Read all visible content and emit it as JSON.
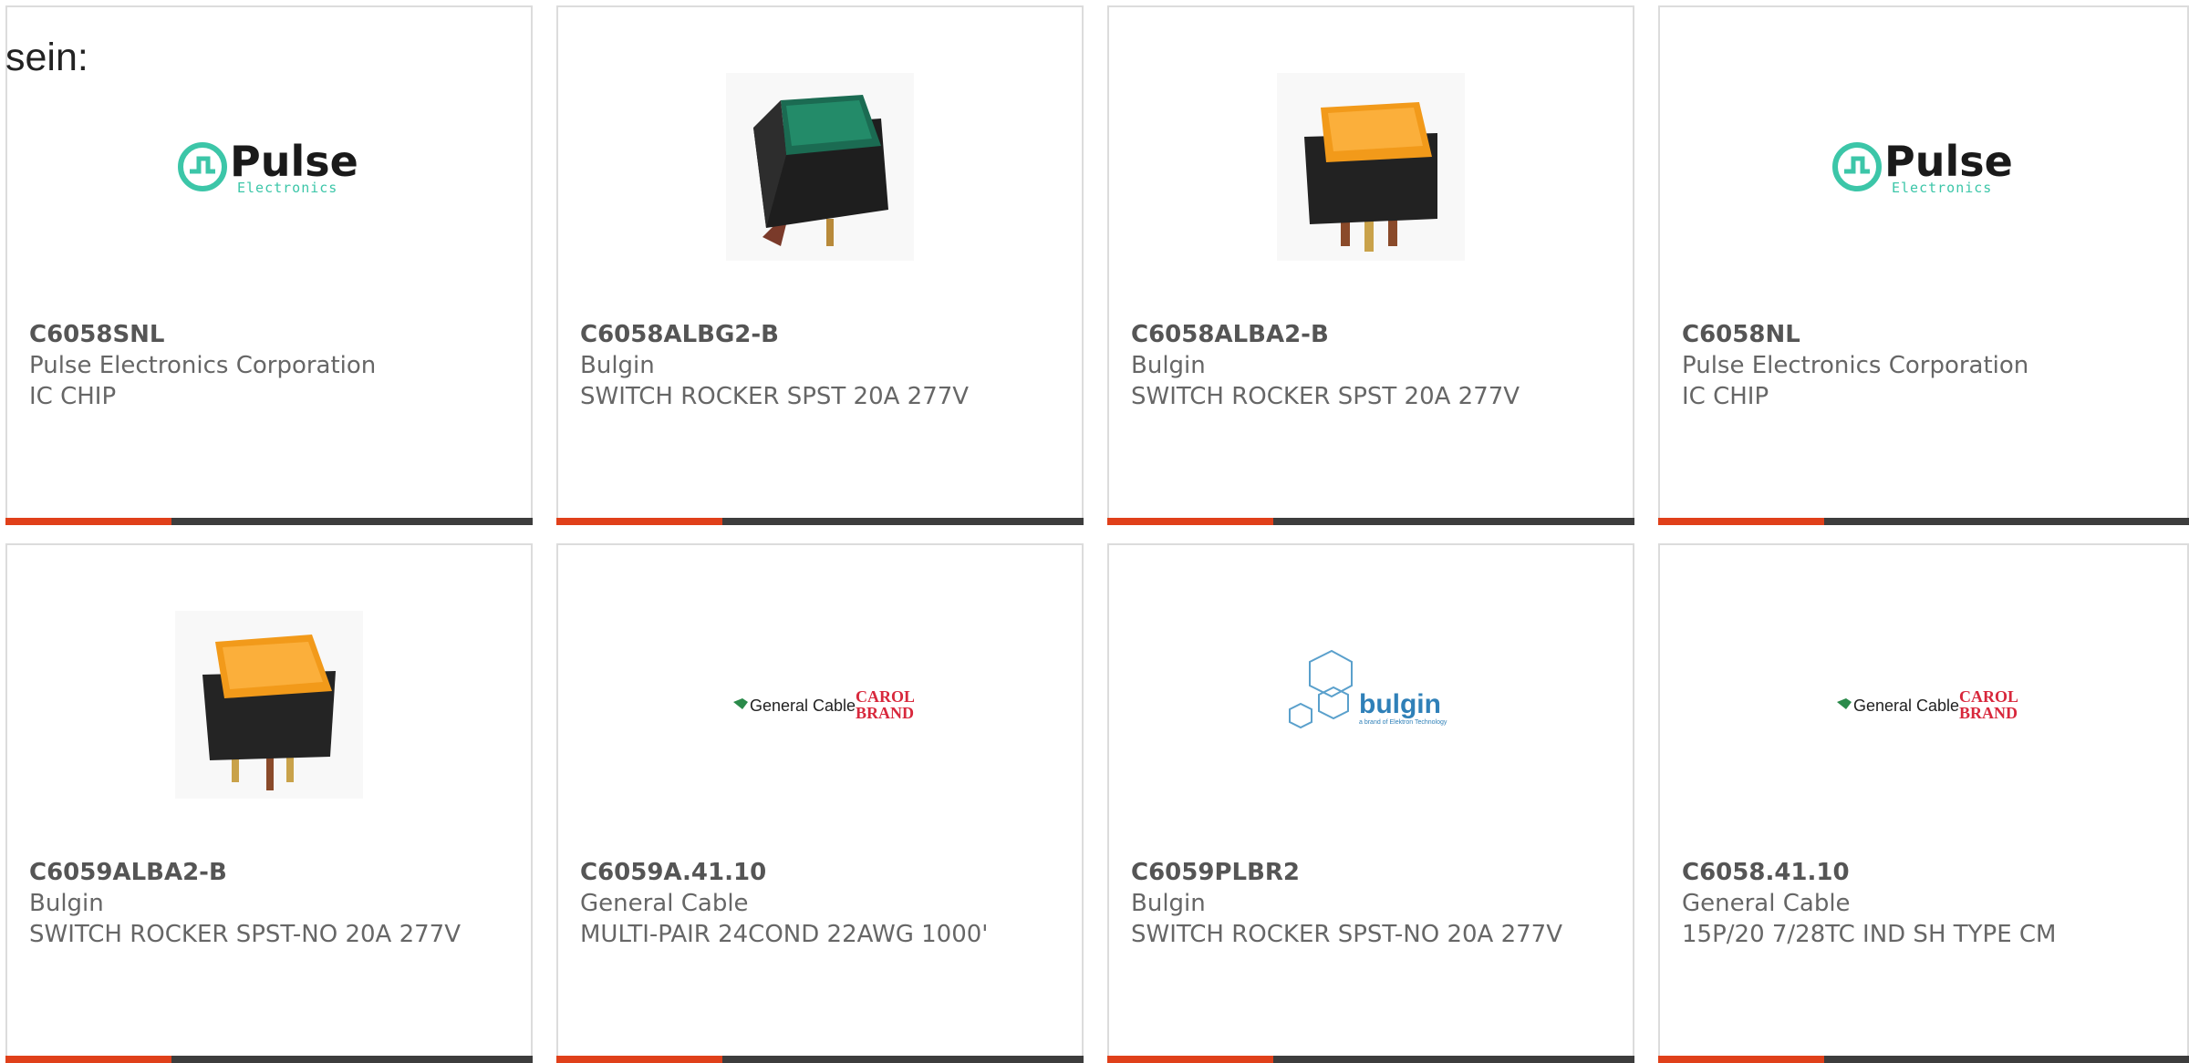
{
  "intro_text": "sein:",
  "colors": {
    "accent": "#e0401a",
    "bar": "#3d3d3d",
    "border": "#dcdcdc",
    "text": "#666666"
  },
  "products": [
    {
      "part_number": "C6058SNL",
      "manufacturer": "Pulse Electronics Corporation",
      "description": "IC CHIP",
      "image": "pulse-electronics-logo"
    },
    {
      "part_number": "C6058ALBG2-B",
      "manufacturer": "Bulgin",
      "description": "SWITCH ROCKER SPST 20A 277V",
      "image": "green-rocker-switch"
    },
    {
      "part_number": "C6058ALBA2-B",
      "manufacturer": "Bulgin",
      "description": "SWITCH ROCKER SPST 20A 277V",
      "image": "amber-rocker-switch"
    },
    {
      "part_number": "C6058NL",
      "manufacturer": "Pulse Electronics Corporation",
      "description": "IC CHIP",
      "image": "pulse-electronics-logo"
    },
    {
      "part_number": "C6059ALBA2-B",
      "manufacturer": "Bulgin",
      "description": "SWITCH ROCKER SPST-NO 20A 277V",
      "image": "amber-rocker-switch"
    },
    {
      "part_number": "C6059A.41.10",
      "manufacturer": "General Cable",
      "description": "MULTI-PAIR 24COND 22AWG 1000'",
      "image": "general-cable-carol-logo"
    },
    {
      "part_number": "C6059PLBR2",
      "manufacturer": "Bulgin",
      "description": "SWITCH ROCKER SPST-NO 20A 277V",
      "image": "bulgin-logo"
    },
    {
      "part_number": "C6058.41.10",
      "manufacturer": "General Cable",
      "description": "15P/20 7/28TC IND SH TYPE CM",
      "image": "general-cable-carol-logo"
    }
  ],
  "logos": {
    "pulse": {
      "word": "Pulse",
      "sub": "Electronics"
    },
    "general_cable": {
      "word": "General Cable",
      "carol_line1": "CAROL",
      "carol_line2": "BRAND"
    },
    "bulgin": {
      "word": "bulgin",
      "tagline": "a brand of Elektron Technology"
    }
  }
}
